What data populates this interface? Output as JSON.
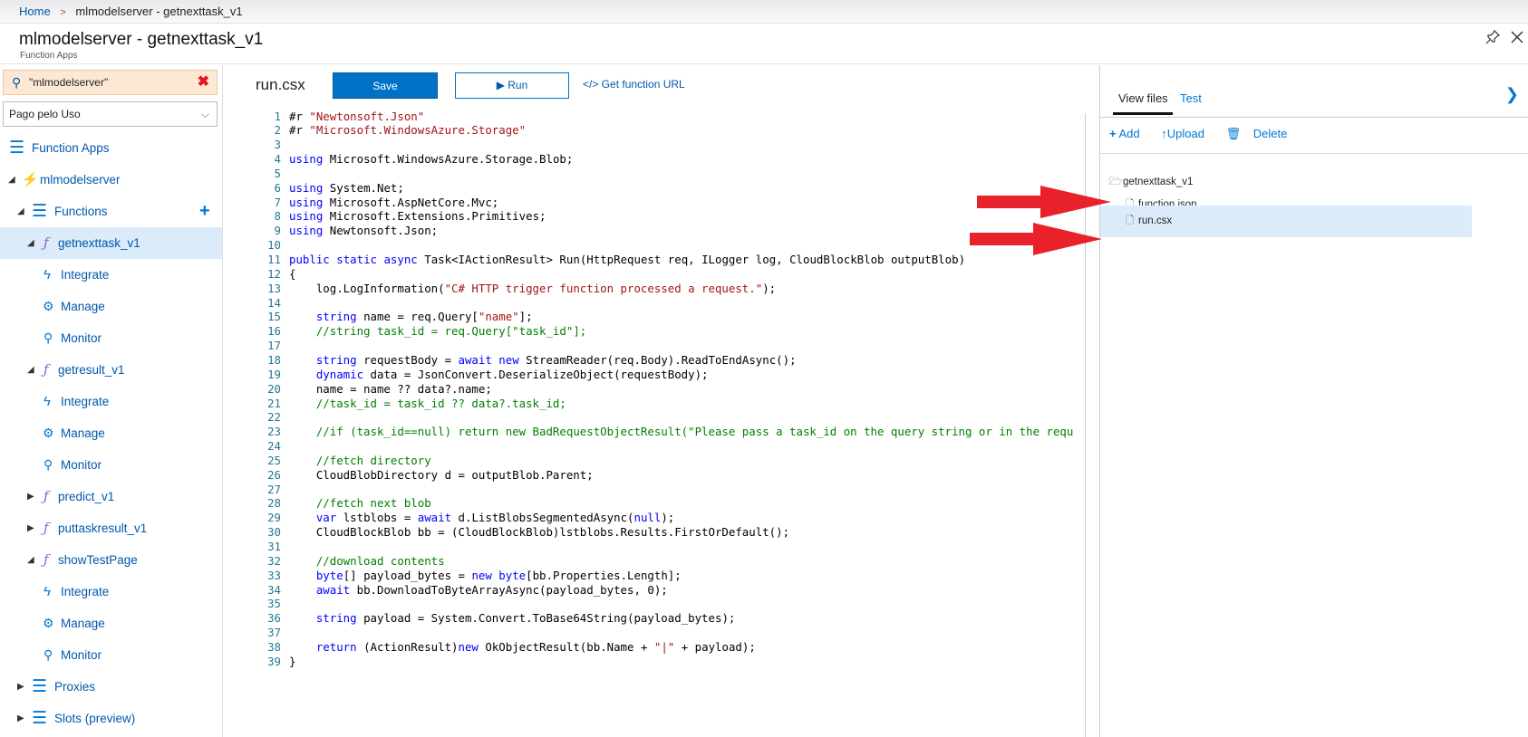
{
  "breadcrumb": {
    "home": "Home",
    "sep": ">",
    "current": "mlmodelserver - getnexttask_v1"
  },
  "header": {
    "title": "mlmodelserver - getnexttask_v1",
    "subtitle": "Function Apps"
  },
  "sidebar": {
    "search_value": "\"mlmodelserver\"",
    "subscription": "Pago pelo Uso",
    "items": [
      {
        "label": "Function Apps"
      },
      {
        "label": "mlmodelserver"
      },
      {
        "label": "Functions"
      },
      {
        "label": "getnexttask_v1"
      },
      {
        "label": "Integrate"
      },
      {
        "label": "Manage"
      },
      {
        "label": "Monitor"
      },
      {
        "label": "getresult_v1"
      },
      {
        "label": "Integrate"
      },
      {
        "label": "Manage"
      },
      {
        "label": "Monitor"
      },
      {
        "label": "predict_v1"
      },
      {
        "label": "puttaskresult_v1"
      },
      {
        "label": "showTestPage"
      },
      {
        "label": "Integrate"
      },
      {
        "label": "Manage"
      },
      {
        "label": "Monitor"
      },
      {
        "label": "Proxies"
      },
      {
        "label": "Slots (preview)"
      }
    ]
  },
  "editor": {
    "file_title": "run.csx",
    "save_label": "Save",
    "run_label": "▶ Run",
    "function_url_label": "</> Get function URL",
    "lines": [
      "#r \"Newtonsoft.Json\"",
      "#r \"Microsoft.WindowsAzure.Storage\"",
      "",
      "using Microsoft.WindowsAzure.Storage.Blob;",
      "",
      "using System.Net;",
      "using Microsoft.AspNetCore.Mvc;",
      "using Microsoft.Extensions.Primitives;",
      "using Newtonsoft.Json;",
      "",
      "public static async Task<IActionResult> Run(HttpRequest req, ILogger log, CloudBlockBlob outputBlob)",
      "{",
      "    log.LogInformation(\"C# HTTP trigger function processed a request.\");",
      "",
      "    string name = req.Query[\"name\"];",
      "    //string task_id = req.Query[\"task_id\"];",
      "",
      "    string requestBody = await new StreamReader(req.Body).ReadToEndAsync();",
      "    dynamic data = JsonConvert.DeserializeObject(requestBody);",
      "    name = name ?? data?.name;",
      "    //task_id = task_id ?? data?.task_id;",
      "",
      "    //if (task_id==null) return new BadRequestObjectResult(\"Please pass a task_id on the query string or in the requ",
      "",
      "    //fetch directory",
      "    CloudBlobDirectory d = outputBlob.Parent;",
      "",
      "    //fetch next blob",
      "    var lstblobs = await d.ListBlobsSegmentedAsync(null);",
      "    CloudBlockBlob bb = (CloudBlockBlob)lstblobs.Results.FirstOrDefault();",
      "",
      "    //download contents",
      "    byte[] payload_bytes = new byte[bb.Properties.Length];",
      "    await bb.DownloadToByteArrayAsync(payload_bytes, 0);",
      "",
      "    string payload = System.Convert.ToBase64String(payload_bytes);",
      "",
      "    return (ActionResult)new OkObjectResult(bb.Name + \"|\" + payload);",
      "}"
    ]
  },
  "right_panel": {
    "tab_view_files": "View files",
    "tab_test": "Test",
    "add_label": "Add",
    "upload_label": "Upload",
    "delete_label": "Delete",
    "folder": "getnexttask_v1",
    "files": [
      "function.json",
      "run.csx"
    ]
  },
  "colors": {
    "accent": "#0072c6",
    "selected_bg": "#dcebf9",
    "arrow": "#e8212b"
  }
}
